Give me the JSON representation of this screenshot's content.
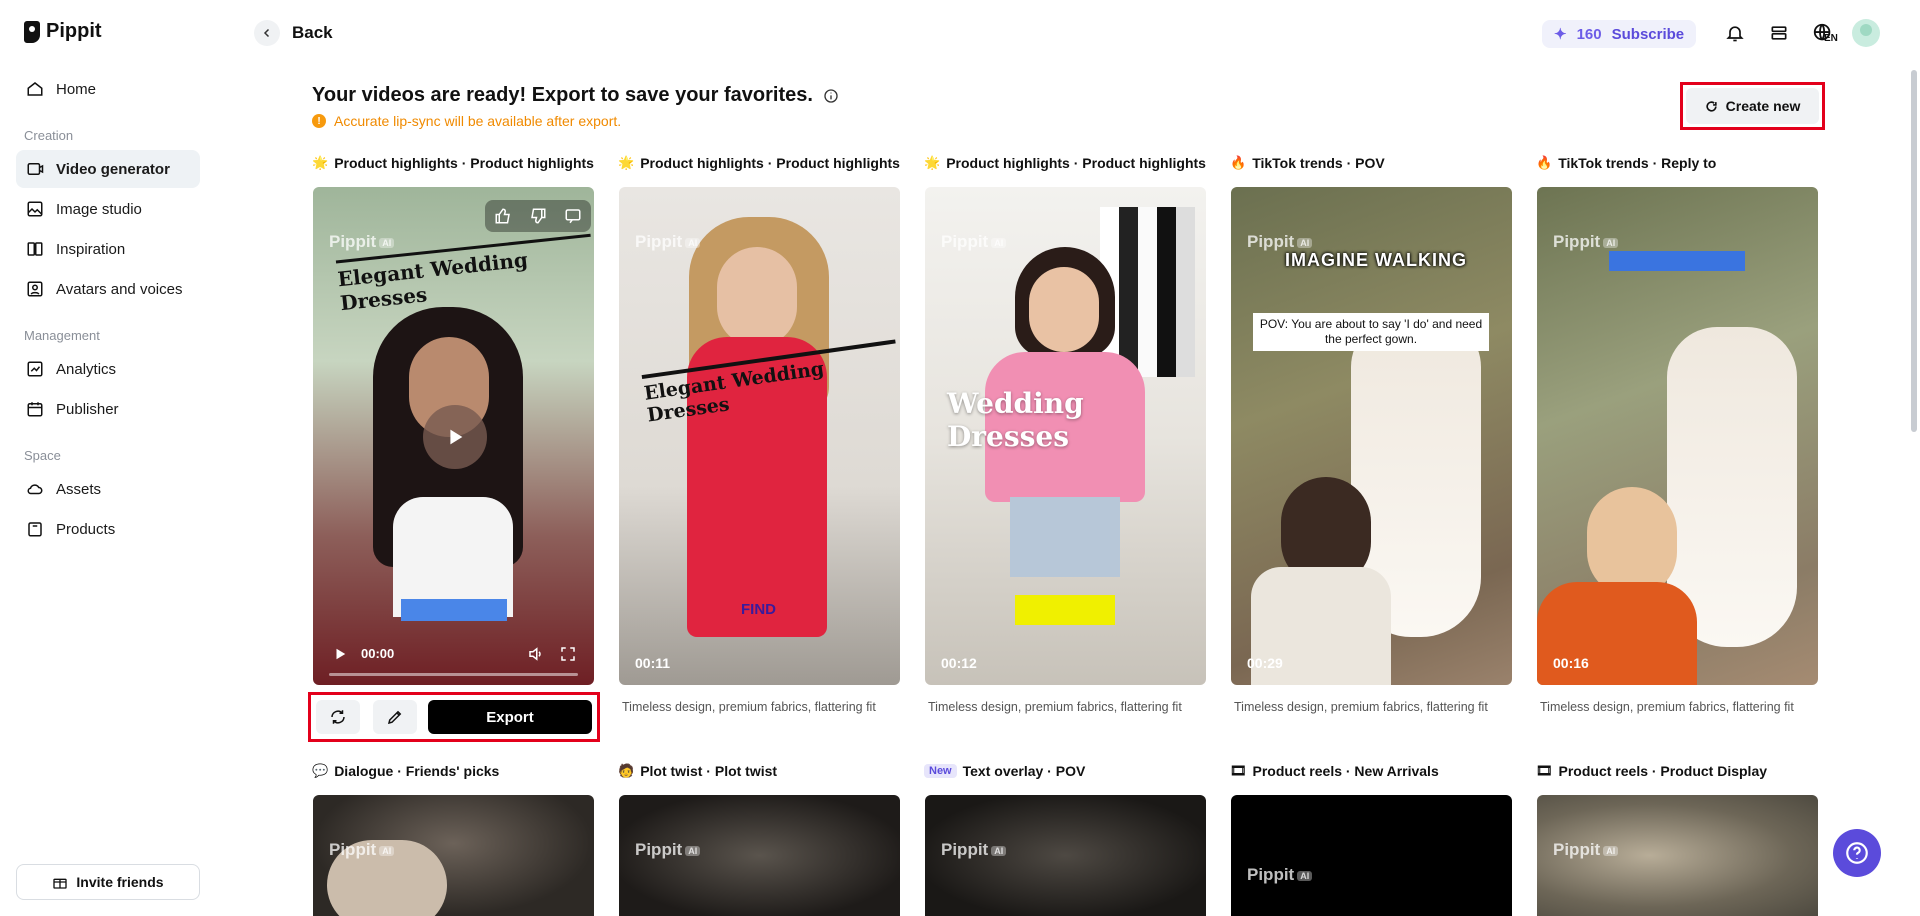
{
  "app": {
    "name": "Pippit"
  },
  "sidebar": {
    "items": [
      {
        "label": "Home",
        "icon": "home-icon"
      },
      {
        "label": "Video generator",
        "icon": "video-icon"
      },
      {
        "label": "Image studio",
        "icon": "image-icon"
      },
      {
        "label": "Inspiration",
        "icon": "inspiration-icon"
      },
      {
        "label": "Avatars and voices",
        "icon": "avatar-icon"
      },
      {
        "label": "Analytics",
        "icon": "analytics-icon"
      },
      {
        "label": "Publisher",
        "icon": "calendar-icon"
      },
      {
        "label": "Assets",
        "icon": "cloud-icon"
      },
      {
        "label": "Products",
        "icon": "bag-icon"
      }
    ],
    "sections": [
      "Creation",
      "Management",
      "Space"
    ],
    "invite_label": "Invite friends"
  },
  "topbar": {
    "back_label": "Back",
    "credits": "160",
    "subscribe_label": "Subscribe",
    "lang": "EN"
  },
  "main": {
    "heading": "Your videos are ready! Export to save your favorites.",
    "notice": "Accurate lip-sync will be available after export.",
    "create_new_label": "Create new",
    "export_label": "Export",
    "player_time": "00:00",
    "cards": [
      {
        "title": "Product highlights · Product highlights",
        "caption": "Timeless design, premium fabrics, flattering fit",
        "overlay": "Elegant Wedding Dresses"
      },
      {
        "title": "Product highlights · Product highlights",
        "caption": "Timeless design, premium fabrics, flattering fit",
        "overlay": "Elegant Wedding Dresses",
        "duration": "00:11",
        "tag": "FIND"
      },
      {
        "title": "Product highlights · Product highlights",
        "caption": "Timeless design, premium fabrics, flattering fit",
        "overlay": "Wedding Dresses",
        "duration": "00:12"
      },
      {
        "title": "TikTok trends · POV",
        "caption": "Timeless design, premium fabrics, flattering fit",
        "overlay": "IMAGINE WALKING",
        "bubble": "POV: You are about to say 'I do' and need the perfect gown.",
        "duration": "00:29"
      },
      {
        "title": "TikTok trends · Reply to",
        "caption": "Timeless design, premium fabrics, flattering fit",
        "duration": "00:16"
      }
    ],
    "row2": [
      {
        "title": "Dialogue · Friends' picks"
      },
      {
        "title": "Plot twist · Plot twist"
      },
      {
        "title": "Text overlay · POV",
        "badge": "New"
      },
      {
        "title": "Product reels · New Arrivals"
      },
      {
        "title": "Product reels · Product Display"
      }
    ],
    "watermark": "Pippit",
    "watermark_badge": "AI"
  },
  "colors": {
    "accent": "#5b4bdb",
    "highlight_border": "#e3001b",
    "notice": "#f08a00"
  }
}
